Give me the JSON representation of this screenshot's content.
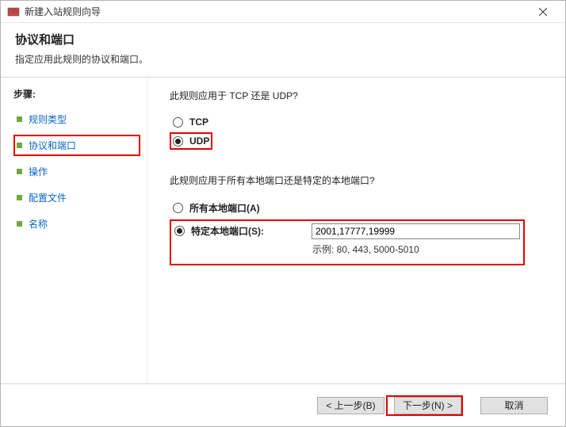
{
  "window": {
    "title": "新建入站规则向导"
  },
  "header": {
    "title": "协议和端口",
    "subtitle": "指定应用此规则的协议和端口。"
  },
  "sidebar": {
    "title": "步骤:",
    "items": [
      {
        "label": "规则类型"
      },
      {
        "label": "协议和端口"
      },
      {
        "label": "操作"
      },
      {
        "label": "配置文件"
      },
      {
        "label": "名称"
      }
    ]
  },
  "main": {
    "q1": "此规则应用于 TCP 还是 UDP?",
    "opt_tcp": "TCP",
    "opt_udp": "UDP",
    "q2": "此规则应用于所有本地端口还是特定的本地端口?",
    "opt_all_ports": "所有本地端口(A)",
    "opt_specific_ports": "特定本地端口(S):",
    "port_value": "2001,17777,19999",
    "port_example": "示例: 80, 443, 5000-5010"
  },
  "footer": {
    "back": "< 上一步(B)",
    "next": "下一步(N) >",
    "cancel": "取消"
  }
}
